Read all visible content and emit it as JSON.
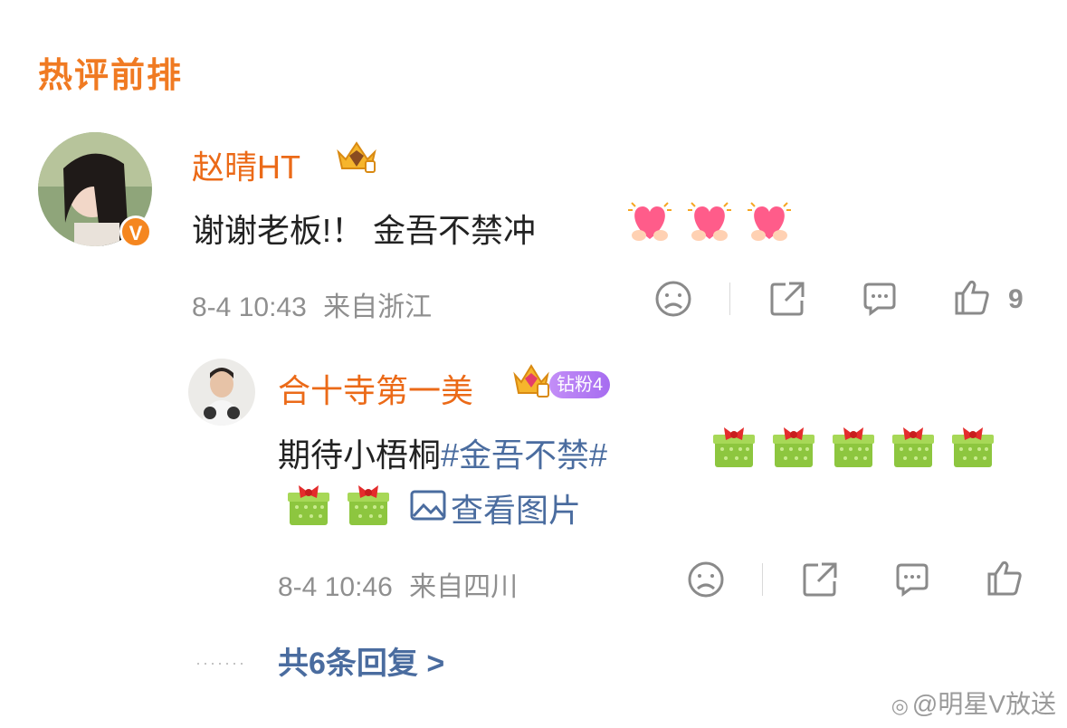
{
  "section_title": "热评前排",
  "comment": {
    "username": "赵晴HT",
    "verified_badge": "V",
    "text": "谢谢老板!！ 金吾不禁冲",
    "timestamp": "8-4 10:43",
    "location": "来自浙江",
    "like_count": "9"
  },
  "reply": {
    "username": "合十寺第一美",
    "fan_badge": "钻粉4",
    "text_prefix": "期待小梧桐",
    "hashtag": "#金吾不禁#",
    "view_image_label": "查看图片",
    "timestamp": "8-4 10:46",
    "location": "来自四川"
  },
  "more_replies": "共6条回复 >",
  "watermark": "@明星V放送",
  "colors": {
    "accent": "#f07a22",
    "username": "#eb6a18",
    "link": "#4a6c9f",
    "meta": "#8f8f8f"
  },
  "icons": [
    "crown-badge-icon",
    "heart-hands-emoji",
    "dislike-face-icon",
    "share-icon",
    "comment-icon",
    "like-thumb-icon",
    "gift-emoji",
    "image-icon"
  ]
}
